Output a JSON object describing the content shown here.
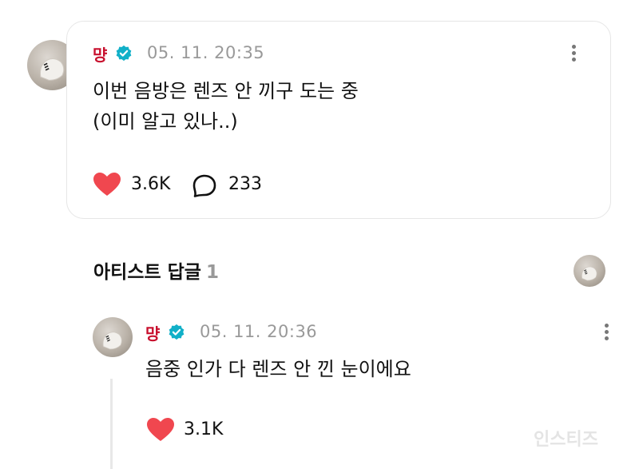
{
  "post": {
    "author": "먕",
    "timestamp": "05. 11. 20:35",
    "text_line1": "이번 음방은 렌즈 안 끼구 도는 중",
    "text_line2": "(이미 알고 있나..)",
    "likes": "3.6K",
    "comments": "233"
  },
  "artist_replies": {
    "title": "아티스트 답글",
    "count": "1"
  },
  "reply": {
    "author": "먕",
    "timestamp": "05. 11. 20:36",
    "text": "음중 인가 다 렌즈 안 낀 눈이에요",
    "likes": "3.1K"
  },
  "watermark": "인스티즈",
  "colors": {
    "heart": "#f0474f",
    "verified": "#11b0c8",
    "name": "#c8102e"
  }
}
